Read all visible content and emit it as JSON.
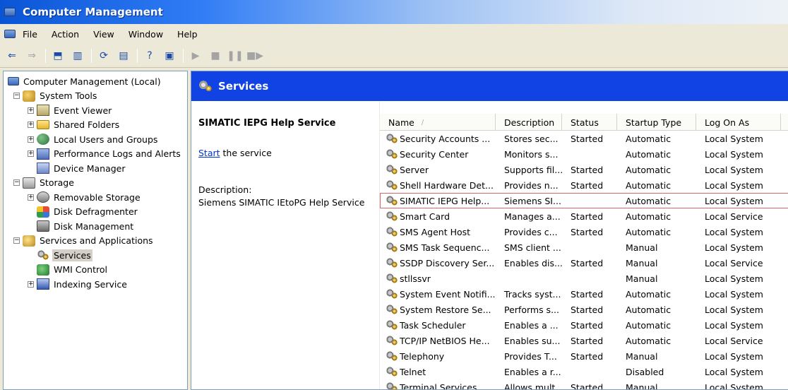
{
  "window": {
    "title": "Computer Management"
  },
  "menu": [
    "File",
    "Action",
    "View",
    "Window",
    "Help"
  ],
  "toolbar": {
    "buttons": [
      "back-arrow-icon",
      "forward-arrow-icon",
      "up-folder-icon",
      "show-hide-tree-icon",
      "refresh-icon",
      "export-list-icon",
      "help-icon",
      "properties-icon",
      "play-icon",
      "stop-icon",
      "pause-icon",
      "restart-icon"
    ]
  },
  "tree": [
    {
      "label": "Computer Management (Local)",
      "icon": "computer",
      "level": 0,
      "expander": ""
    },
    {
      "label": "System Tools",
      "icon": "tools",
      "level": 1,
      "expander": "−"
    },
    {
      "label": "Event Viewer",
      "icon": "event",
      "level": 2,
      "expander": "+"
    },
    {
      "label": "Shared Folders",
      "icon": "folder",
      "level": 2,
      "expander": "+"
    },
    {
      "label": "Local Users and Groups",
      "icon": "users",
      "level": 2,
      "expander": "+"
    },
    {
      "label": "Performance Logs and Alerts",
      "icon": "perf",
      "level": 2,
      "expander": "+"
    },
    {
      "label": "Device Manager",
      "icon": "device",
      "level": 2,
      "expander": ""
    },
    {
      "label": "Storage",
      "icon": "storage",
      "level": 1,
      "expander": "−"
    },
    {
      "label": "Removable Storage",
      "icon": "removable",
      "level": 2,
      "expander": "+"
    },
    {
      "label": "Disk Defragmenter",
      "icon": "defrag",
      "level": 2,
      "expander": ""
    },
    {
      "label": "Disk Management",
      "icon": "diskmgmt",
      "level": 2,
      "expander": ""
    },
    {
      "label": "Services and Applications",
      "icon": "sa",
      "level": 1,
      "expander": "−"
    },
    {
      "label": "Services",
      "icon": "gears",
      "level": 2,
      "expander": "",
      "selected": true
    },
    {
      "label": "WMI Control",
      "icon": "wmi",
      "level": 2,
      "expander": ""
    },
    {
      "label": "Indexing Service",
      "icon": "index",
      "level": 2,
      "expander": "+"
    }
  ],
  "services_panel": {
    "title": "Services",
    "selected_service": "SIMATIC IEPG Help Service",
    "start_link": "Start",
    "start_suffix": " the service",
    "description_label": "Description:",
    "description_text": "Siemens SIMATIC IEtoPG Help Service"
  },
  "list": {
    "columns": [
      "Name",
      "Description",
      "Status",
      "Startup Type",
      "Log On As"
    ],
    "rows": [
      {
        "name": "Security Accounts ...",
        "desc": "Stores sec...",
        "status": "Started",
        "startup": "Automatic",
        "logon": "Local System"
      },
      {
        "name": "Security Center",
        "desc": "Monitors s...",
        "status": "",
        "startup": "Automatic",
        "logon": "Local System"
      },
      {
        "name": "Server",
        "desc": "Supports fil...",
        "status": "Started",
        "startup": "Automatic",
        "logon": "Local System"
      },
      {
        "name": "Shell Hardware Det...",
        "desc": "Provides n...",
        "status": "Started",
        "startup": "Automatic",
        "logon": "Local System"
      },
      {
        "name": "SIMATIC IEPG Help...",
        "desc": "Siemens SI...",
        "status": "",
        "startup": "Automatic",
        "logon": "Local System",
        "highlight": true
      },
      {
        "name": "Smart Card",
        "desc": "Manages a...",
        "status": "Started",
        "startup": "Automatic",
        "logon": "Local Service"
      },
      {
        "name": "SMS Agent Host",
        "desc": "Provides c...",
        "status": "Started",
        "startup": "Automatic",
        "logon": "Local System"
      },
      {
        "name": "SMS Task Sequenc...",
        "desc": "SMS client ...",
        "status": "",
        "startup": "Manual",
        "logon": "Local System"
      },
      {
        "name": "SSDP Discovery Ser...",
        "desc": "Enables dis...",
        "status": "Started",
        "startup": "Manual",
        "logon": "Local Service"
      },
      {
        "name": "stllssvr",
        "desc": "",
        "status": "",
        "startup": "Manual",
        "logon": "Local System"
      },
      {
        "name": "System Event Notifi...",
        "desc": "Tracks syst...",
        "status": "Started",
        "startup": "Automatic",
        "logon": "Local System"
      },
      {
        "name": "System Restore Se...",
        "desc": "Performs s...",
        "status": "Started",
        "startup": "Automatic",
        "logon": "Local System"
      },
      {
        "name": "Task Scheduler",
        "desc": "Enables a ...",
        "status": "Started",
        "startup": "Automatic",
        "logon": "Local System"
      },
      {
        "name": "TCP/IP NetBIOS He...",
        "desc": "Enables su...",
        "status": "Started",
        "startup": "Automatic",
        "logon": "Local Service"
      },
      {
        "name": "Telephony",
        "desc": "Provides T...",
        "status": "Started",
        "startup": "Manual",
        "logon": "Local System"
      },
      {
        "name": "Telnet",
        "desc": "Enables a r...",
        "status": "",
        "startup": "Disabled",
        "logon": "Local System"
      },
      {
        "name": "Terminal Services",
        "desc": "Allows mult...",
        "status": "Started",
        "startup": "Manual",
        "logon": "Local System"
      }
    ]
  }
}
